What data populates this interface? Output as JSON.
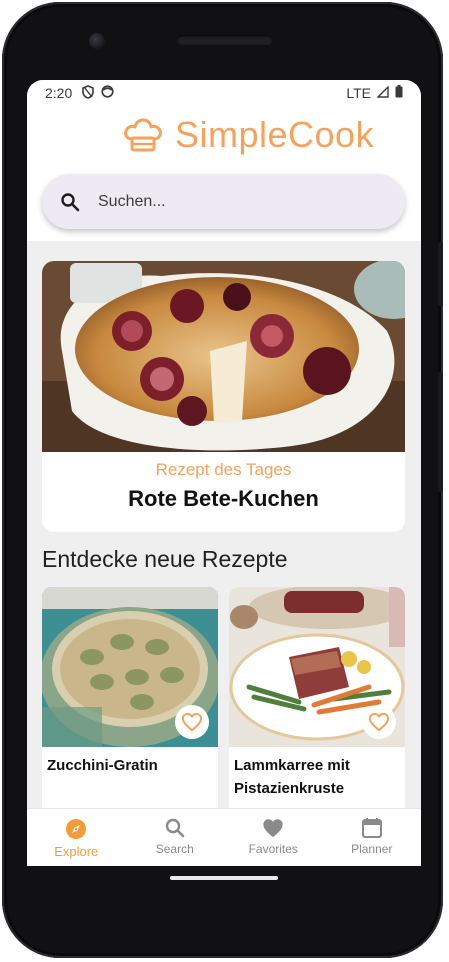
{
  "status": {
    "time": "2:20",
    "network": "LTE"
  },
  "app": {
    "name": "SimpleCook",
    "accent": "#f4a25d"
  },
  "search": {
    "placeholder": "Suchen..."
  },
  "recipe_of_day": {
    "label": "Rezept des Tages",
    "title": "Rote Bete-Kuchen",
    "image": "beetroot-cake-photo"
  },
  "discover": {
    "title": "Entdecke neue Rezepte",
    "recipes": [
      {
        "title": "Zucchini-Gratin",
        "image": "zucchini-gratin-photo",
        "favorite": false
      },
      {
        "title": "Lammkarree mit Pistazienkruste",
        "image": "lamb-rack-photo",
        "favorite": false
      }
    ]
  },
  "nav": {
    "items": [
      {
        "label": "Explore",
        "icon": "compass-icon",
        "active": true
      },
      {
        "label": "Search",
        "icon": "search-icon",
        "active": false
      },
      {
        "label": "Favorites",
        "icon": "heart-icon",
        "active": false
      },
      {
        "label": "Planner",
        "icon": "calendar-icon",
        "active": false
      }
    ]
  }
}
